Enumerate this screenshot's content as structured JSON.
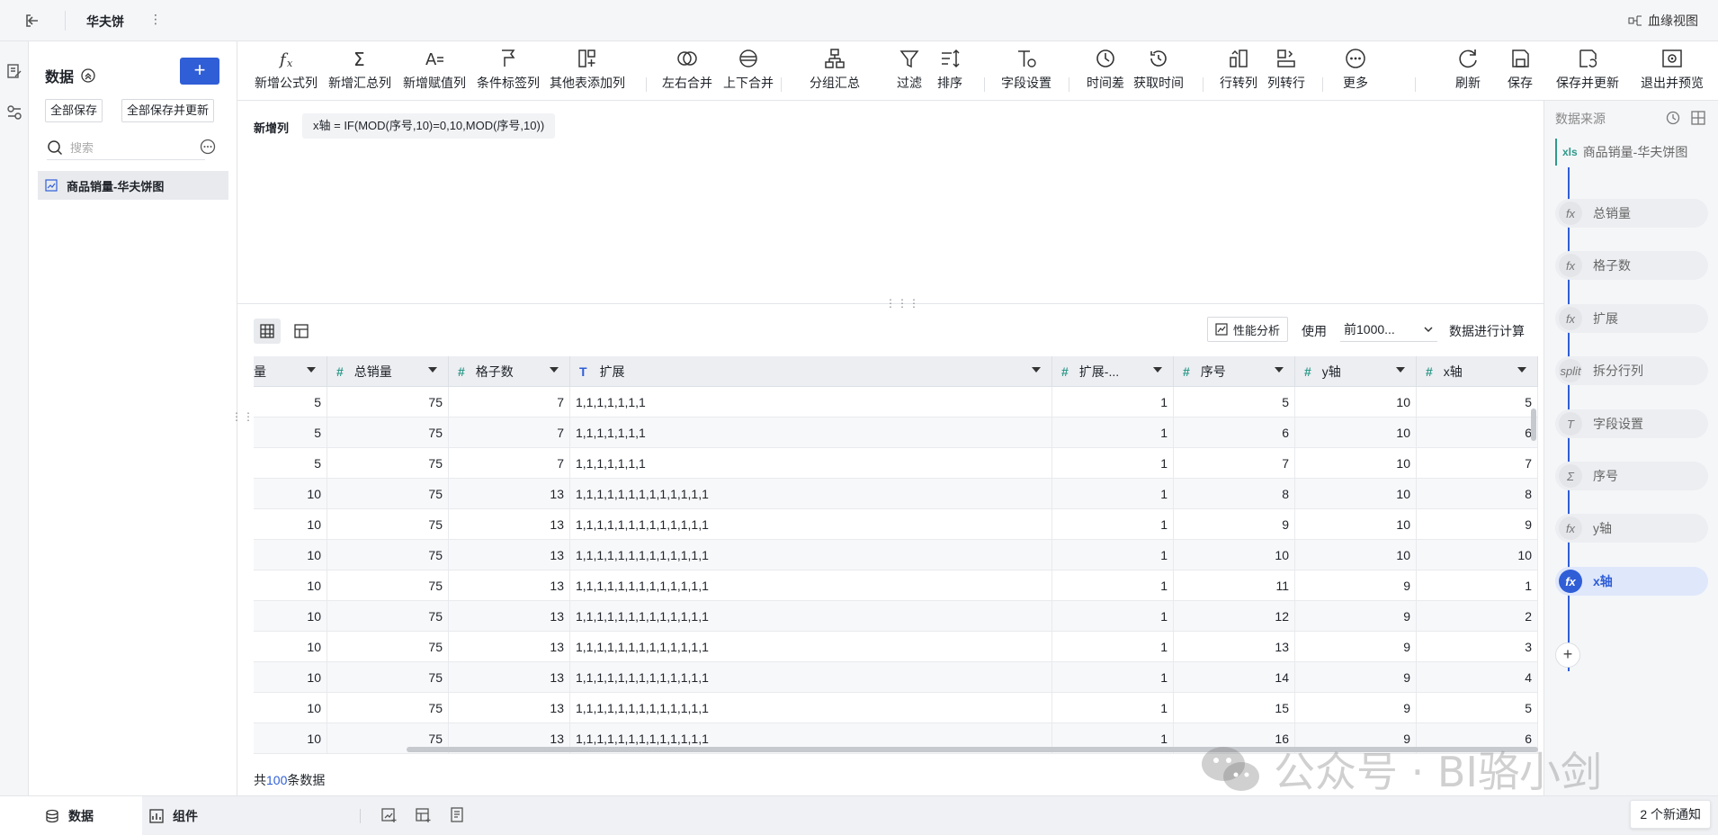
{
  "topbar": {
    "title": "华夫饼",
    "lineage_label": "血缘视图"
  },
  "left": {
    "title": "数据",
    "add_label": "+",
    "save_all": "全部保存",
    "save_all_update": "全部保存并更新",
    "search_placeholder": "搜索",
    "dataset_name": "商品销量-华夫饼图"
  },
  "toolbar": {
    "items": [
      {
        "label": "新增公式列",
        "icon": "function-icon"
      },
      {
        "label": "新增汇总列",
        "icon": "sigma-icon"
      },
      {
        "label": "新增赋值列",
        "icon": "assign-icon"
      },
      {
        "label": "条件标签列",
        "icon": "flag-icon"
      },
      {
        "label": "其他表添加列",
        "icon": "add-column-icon"
      },
      {
        "label": "左右合并",
        "icon": "merge-lr-icon"
      },
      {
        "label": "上下合并",
        "icon": "merge-ud-icon"
      },
      {
        "label": "分组汇总",
        "icon": "group-icon"
      },
      {
        "label": "过滤",
        "icon": "filter-icon"
      },
      {
        "label": "排序",
        "icon": "sort-icon"
      },
      {
        "label": "字段设置",
        "icon": "field-settings-icon"
      },
      {
        "label": "时间差",
        "icon": "clock-icon"
      },
      {
        "label": "获取时间",
        "icon": "time-get-icon"
      },
      {
        "label": "行转列",
        "icon": "row-to-col-icon"
      },
      {
        "label": "列转行",
        "icon": "col-to-row-icon"
      },
      {
        "label": "更多",
        "icon": "more-icon"
      },
      {
        "label": "刷新",
        "icon": "refresh-icon"
      },
      {
        "label": "保存",
        "icon": "save-icon"
      },
      {
        "label": "保存并更新",
        "icon": "save-update-icon"
      },
      {
        "label": "退出并预览",
        "icon": "exit-preview-icon"
      }
    ]
  },
  "editor": {
    "label": "新增列",
    "formula": "x轴 = IF(MOD(序号,10)=0,10,MOD(序号,10))"
  },
  "grid": {
    "perf_label": "性能分析",
    "use_label": "使用",
    "use_value": "前1000...",
    "calc_label": "数据进行计算",
    "columns": [
      {
        "name": "量",
        "type": "num"
      },
      {
        "name": "总销量",
        "type": "num"
      },
      {
        "name": "格子数",
        "type": "num"
      },
      {
        "name": "扩展",
        "type": "text"
      },
      {
        "name": "扩展-...",
        "type": "num"
      },
      {
        "name": "序号",
        "type": "num"
      },
      {
        "name": "y轴",
        "type": "num"
      },
      {
        "name": "x轴",
        "type": "num"
      }
    ],
    "rows": [
      [
        "5",
        "75",
        "7",
        "1,1,1,1,1,1,1",
        "1",
        "5",
        "10",
        "5"
      ],
      [
        "5",
        "75",
        "7",
        "1,1,1,1,1,1,1",
        "1",
        "6",
        "10",
        "6"
      ],
      [
        "5",
        "75",
        "7",
        "1,1,1,1,1,1,1",
        "1",
        "7",
        "10",
        "7"
      ],
      [
        "10",
        "75",
        "13",
        "1,1,1,1,1,1,1,1,1,1,1,1,1",
        "1",
        "8",
        "10",
        "8"
      ],
      [
        "10",
        "75",
        "13",
        "1,1,1,1,1,1,1,1,1,1,1,1,1",
        "1",
        "9",
        "10",
        "9"
      ],
      [
        "10",
        "75",
        "13",
        "1,1,1,1,1,1,1,1,1,1,1,1,1",
        "1",
        "10",
        "10",
        "10"
      ],
      [
        "10",
        "75",
        "13",
        "1,1,1,1,1,1,1,1,1,1,1,1,1",
        "1",
        "11",
        "9",
        "1"
      ],
      [
        "10",
        "75",
        "13",
        "1,1,1,1,1,1,1,1,1,1,1,1,1",
        "1",
        "12",
        "9",
        "2"
      ],
      [
        "10",
        "75",
        "13",
        "1,1,1,1,1,1,1,1,1,1,1,1,1",
        "1",
        "13",
        "9",
        "3"
      ],
      [
        "10",
        "75",
        "13",
        "1,1,1,1,1,1,1,1,1,1,1,1,1",
        "1",
        "14",
        "9",
        "4"
      ],
      [
        "10",
        "75",
        "13",
        "1,1,1,1,1,1,1,1,1,1,1,1,1",
        "1",
        "15",
        "9",
        "5"
      ],
      [
        "10",
        "75",
        "13",
        "1,1,1,1,1,1,1,1,1,1,1,1,1",
        "1",
        "16",
        "9",
        "6"
      ]
    ],
    "total_prefix": "共",
    "total_count": "100",
    "total_suffix": "条数据"
  },
  "source": {
    "title": "数据来源",
    "source_name": "商品销量-华夫饼图",
    "source_type": "xls",
    "steps": [
      {
        "label": "总销量",
        "icon": "fx"
      },
      {
        "label": "格子数",
        "icon": "fx"
      },
      {
        "label": "扩展",
        "icon": "fx"
      },
      {
        "label": "拆分行列",
        "icon": "split"
      },
      {
        "label": "字段设置",
        "icon": "T"
      },
      {
        "label": "序号",
        "icon": "Σ"
      },
      {
        "label": "y轴",
        "icon": "fx"
      },
      {
        "label": "x轴",
        "icon": "fx",
        "active": true
      }
    ]
  },
  "bottom": {
    "tab_data": "数据",
    "tab_components": "组件",
    "notify": "2 个新通知"
  },
  "watermark": "公众号 · BI骆小剑",
  "colors": {
    "accent": "#2f5ed6",
    "num_type": "#2f9a8a"
  }
}
